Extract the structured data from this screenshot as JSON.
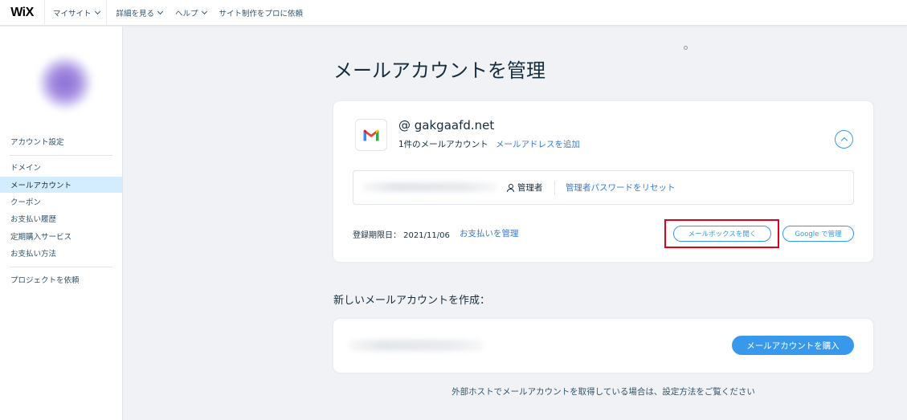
{
  "topbar": {
    "logo": "WiX",
    "nav": [
      {
        "label": "マイサイト",
        "dropdown": true
      },
      {
        "label": "詳細を見る",
        "dropdown": true
      },
      {
        "label": "ヘルプ",
        "dropdown": true
      },
      {
        "label": "サイト制作をプロに依頼",
        "dropdown": false
      }
    ]
  },
  "sidebar": {
    "items": [
      {
        "label": "アカウント設定"
      },
      {
        "label": "ドメイン"
      },
      {
        "label": "メールアカウント",
        "active": true
      },
      {
        "label": "クーポン"
      },
      {
        "label": "お支払い履歴"
      },
      {
        "label": "定期購入サービス"
      },
      {
        "label": "お支払い方法"
      },
      {
        "label": "プロジェクトを依頼"
      }
    ]
  },
  "main": {
    "title": "メールアカウントを管理",
    "account_card": {
      "domain": "@ gakgaafd.net",
      "account_count": "1件のメールアカウント",
      "add_address": "メールアドレスを追加",
      "admin_label": "管理者",
      "reset_password": "管理者パスワードをリセット",
      "expiry": "登録期限日： 2021/11/06",
      "manage_payment": "お支払いを管理",
      "open_mailbox": "メールボックスを開く",
      "google_manage": "Google で管理"
    },
    "new_section_title": "新しいメールアカウントを作成：",
    "buy_button": "メールアカウントを購入",
    "footer_note": "外部ホストでメールアカウントを取得している場合は、設定方法をご覧ください"
  },
  "colors": {
    "accent": "#3899ec",
    "highlight": "#e1001a",
    "active_nav": "#d3edff",
    "background": "#f0f2f5"
  }
}
